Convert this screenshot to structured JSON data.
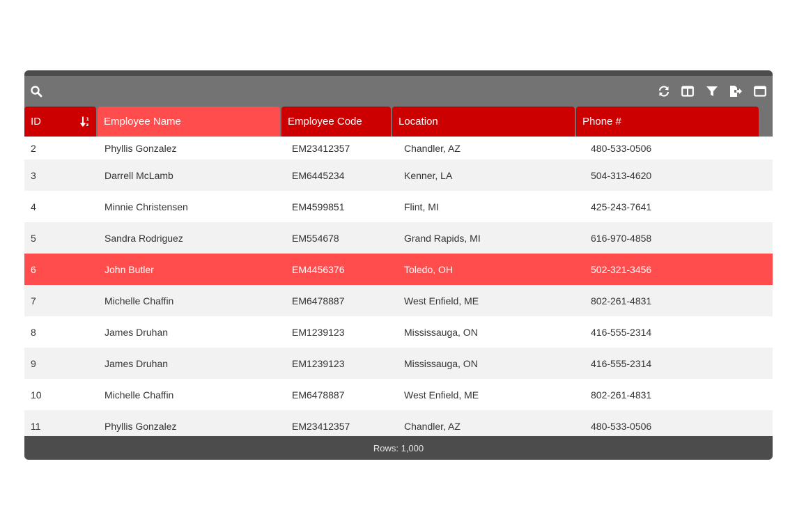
{
  "toolbar": {
    "icons": [
      "search-icon",
      "refresh-icon",
      "columns-icon",
      "filter-icon",
      "export-icon",
      "window-icon"
    ]
  },
  "columns": [
    {
      "label": "ID",
      "sorted": "ascending"
    },
    {
      "label": "Employee Name",
      "active": true
    },
    {
      "label": "Employee Code"
    },
    {
      "label": "Location"
    },
    {
      "label": "Phone #"
    }
  ],
  "rows": [
    {
      "id": "2",
      "name": "Phyllis Gonzalez",
      "code": "EM23412357",
      "location": "Chandler, AZ",
      "phone": "480-533-0506"
    },
    {
      "id": "3",
      "name": "Darrell McLamb",
      "code": "EM6445234",
      "location": "Kenner, LA",
      "phone": "504-313-4620"
    },
    {
      "id": "4",
      "name": "Minnie Christensen",
      "code": "EM4599851",
      "location": "Flint, MI",
      "phone": "425-243-7641"
    },
    {
      "id": "5",
      "name": "Sandra Rodriguez",
      "code": "EM554678",
      "location": "Grand Rapids, MI",
      "phone": "616-970-4858"
    },
    {
      "id": "6",
      "name": "John Butler",
      "code": "EM4456376",
      "location": "Toledo, OH",
      "phone": "502-321-3456",
      "selected": true
    },
    {
      "id": "7",
      "name": "Michelle Chaffin",
      "code": "EM6478887",
      "location": "West Enfield, ME",
      "phone": "802-261-4831"
    },
    {
      "id": "8",
      "name": "James Druhan",
      "code": "EM1239123",
      "location": "Mississauga, ON",
      "phone": "416-555-2314"
    },
    {
      "id": "9",
      "name": "James Druhan",
      "code": "EM1239123",
      "location": "Mississauga, ON",
      "phone": "416-555-2314"
    },
    {
      "id": "10",
      "name": "Michelle Chaffin",
      "code": "EM6478887",
      "location": "West Enfield, ME",
      "phone": "802-261-4831"
    },
    {
      "id": "11",
      "name": "Phyllis Gonzalez",
      "code": "EM23412357",
      "location": "Chandler, AZ",
      "phone": "480-533-0506"
    }
  ],
  "footer": {
    "label": "Rows: 1,000"
  },
  "colors": {
    "header": "#cc0000",
    "accent": "#ff4c4c",
    "toolbar": "#737373",
    "footer": "#4c4c4c"
  }
}
